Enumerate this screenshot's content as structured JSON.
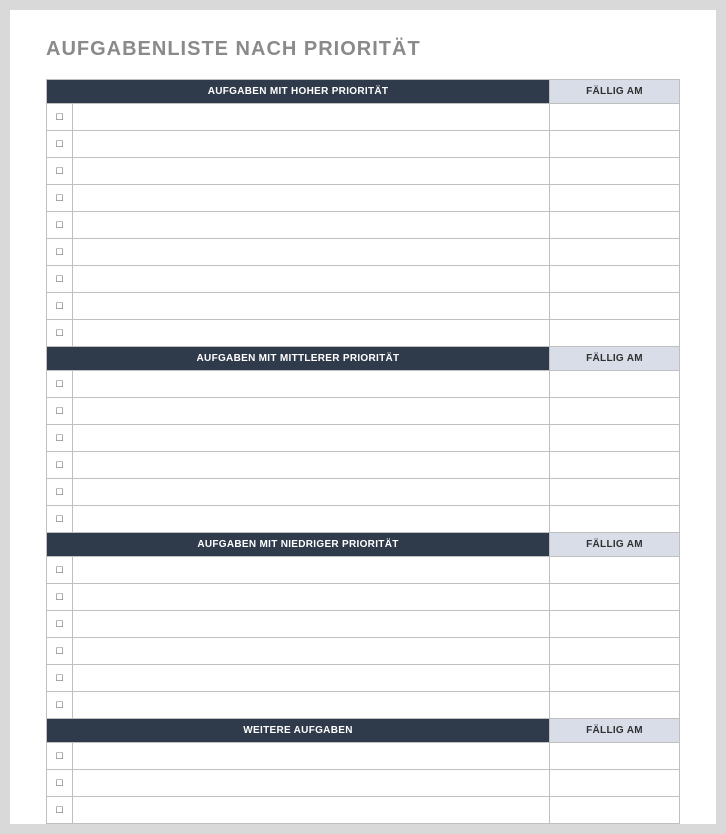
{
  "title": "AUFGABENLISTE NACH PRIORITÄT",
  "due_header": "FÄLLIG AM",
  "checkbox_glyph": "☐",
  "sections": [
    {
      "label": "AUFGABEN MIT HOHER PRIORITÄT",
      "rows": [
        {
          "checked": false,
          "task": "",
          "due": ""
        },
        {
          "checked": false,
          "task": "",
          "due": ""
        },
        {
          "checked": false,
          "task": "",
          "due": ""
        },
        {
          "checked": false,
          "task": "",
          "due": ""
        },
        {
          "checked": false,
          "task": "",
          "due": ""
        },
        {
          "checked": false,
          "task": "",
          "due": ""
        },
        {
          "checked": false,
          "task": "",
          "due": ""
        },
        {
          "checked": false,
          "task": "",
          "due": ""
        },
        {
          "checked": false,
          "task": "",
          "due": ""
        }
      ]
    },
    {
      "label": "AUFGABEN MIT MITTLERER PRIORITÄT",
      "rows": [
        {
          "checked": false,
          "task": "",
          "due": ""
        },
        {
          "checked": false,
          "task": "",
          "due": ""
        },
        {
          "checked": false,
          "task": "",
          "due": ""
        },
        {
          "checked": false,
          "task": "",
          "due": ""
        },
        {
          "checked": false,
          "task": "",
          "due": ""
        },
        {
          "checked": false,
          "task": "",
          "due": ""
        }
      ]
    },
    {
      "label": "AUFGABEN MIT NIEDRIGER PRIORITÄT",
      "rows": [
        {
          "checked": false,
          "task": "",
          "due": ""
        },
        {
          "checked": false,
          "task": "",
          "due": ""
        },
        {
          "checked": false,
          "task": "",
          "due": ""
        },
        {
          "checked": false,
          "task": "",
          "due": ""
        },
        {
          "checked": false,
          "task": "",
          "due": ""
        },
        {
          "checked": false,
          "task": "",
          "due": ""
        }
      ]
    },
    {
      "label": "WEITERE AUFGABEN",
      "rows": [
        {
          "checked": false,
          "task": "",
          "due": ""
        },
        {
          "checked": false,
          "task": "",
          "due": ""
        },
        {
          "checked": false,
          "task": "",
          "due": ""
        }
      ]
    }
  ]
}
